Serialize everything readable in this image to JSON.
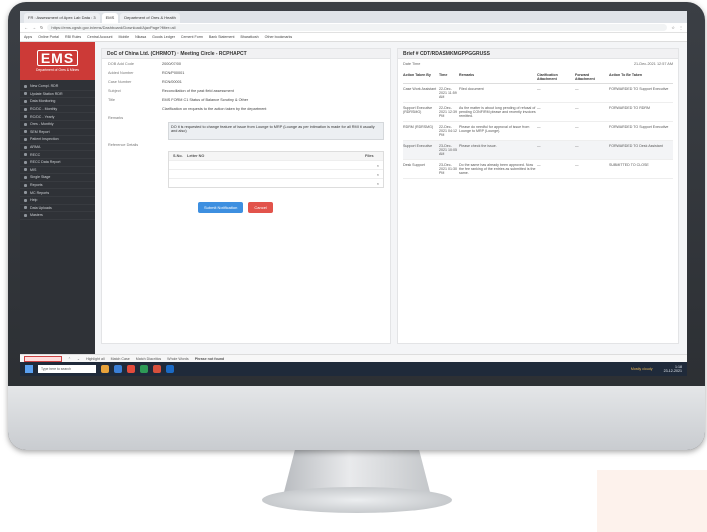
{
  "browser": {
    "tabs": [
      "FR : Assessment of Apex Lab Data : 3",
      "EMS",
      "Department of Ores & Health"
    ],
    "url": "https://ems.cgwb.gov.in/ems/Dashboard/Download/AjaxPage?filter=all",
    "bookmarks": [
      "Apps",
      "Online Portal",
      "RBI Rules",
      "Central Account",
      "Mobile",
      "Nikasa",
      "Goods Ledger",
      "Cement Form",
      "Bank Statement",
      "Bharatkosh",
      "Other bookmarks"
    ]
  },
  "sidebar": {
    "logo": "EMS",
    "subtitle": "Department of Ores & Mines",
    "items": [
      "New Compl. RDR",
      "Update Station RDR",
      "Data Monitoring",
      "RC/DC - Monthly",
      "RC/DC - Yearly",
      "Ores - Monthly",
      "SEM Report",
      "Patient Inspection",
      "ARMA",
      "RECC",
      "RECC Data Report",
      "MIS",
      "Single Stage",
      "Reports",
      "MC Reports",
      "Help",
      "Data Uploads",
      "Masters"
    ]
  },
  "left_card": {
    "title": "DoC of China Ltd. (CHRMOT) · Meeting Circle - RCPHAPCT",
    "fields": [
      {
        "k": "DOB Add Code",
        "v": "2000/07/00"
      },
      {
        "k": "Added Number",
        "v": "RCN/P00001"
      },
      {
        "k": "Case Number",
        "v": "RCN/00001"
      },
      {
        "k": "Subject",
        "v": "Reconciliation of the past field assessment"
      },
      {
        "k": "Title",
        "v": "EMS FORM C1 Status of Balance Scrutiny & Other"
      },
      {
        "k": "",
        "v": "Clarification on requests to the action taken by the department"
      }
    ],
    "remarks_label": "Remarks",
    "remarks_value": "DO it is requested to change feature of issue from Lounge to MRP (Lounge as per intimation is made for all RMI it usually and also)",
    "ref_label": "Reference Details",
    "ref_headers": [
      "S.No.",
      "Letter NO",
      "Files"
    ],
    "submit_label": "Submit Notification",
    "cancel_label": "Cancel"
  },
  "right_card": {
    "title": "Brief # CDT/RDASMKMGPPGGRUSS",
    "date_label": "Date Time",
    "date_value": "21-Dec-2021 12:57 AM",
    "headers": [
      "Action Taken By",
      "Time",
      "Remarks",
      "Clarification Attachment",
      "Forward Attachment",
      "Action To Be Taken"
    ],
    "rows": [
      {
        "by": "Case Work Assistant",
        "time": "22-Dec-2021 11:59 AM",
        "remarks": "Filed document",
        "c": "—",
        "f": "—",
        "to": "FORWARDED TO Support Executive"
      },
      {
        "by": "Support Executive (RDRSMG)",
        "time": "22-Dec-2021 12:39 PM",
        "remarks": "As the matter is about long pending of refusal of pending CONFIRM please and recently invoices remitted.",
        "c": "—",
        "f": "—",
        "to": "FORWARDED TO RDRM"
      },
      {
        "by": "RDRM (RDRSMG)",
        "time": "22-Dec-2021 04:12 PM",
        "remarks": "Please do needful for approval of issue from Lounge to MRP (Lounge).",
        "c": "—",
        "f": "—",
        "to": "FORWARDED TO Support Executive"
      },
      {
        "by": "Support Executive",
        "time": "23-Dec-2021 10:05 AM",
        "remarks": "Please check the issue.",
        "c": "—",
        "f": "—",
        "to": "FORWARDED TO Desk Assistant"
      },
      {
        "by": "Desk Support",
        "time": "23-Dec-2021 01:30 PM",
        "remarks": "Do the same has already been approved. Now the fee ranking of the entries as submitted is the same.",
        "c": "—",
        "f": "—",
        "to": "SUBMITTED TO CLOSE"
      }
    ]
  },
  "findbar": {
    "label": "Highlight all",
    "opts": [
      "Match Case",
      "Match Diacritics",
      "Whole Words"
    ],
    "result": "Phrase not found"
  },
  "taskbar": {
    "search": "Type here to search",
    "clock_time": "1:18",
    "clock_date": "23-12-2021",
    "weather": "Mostly cloudy"
  }
}
